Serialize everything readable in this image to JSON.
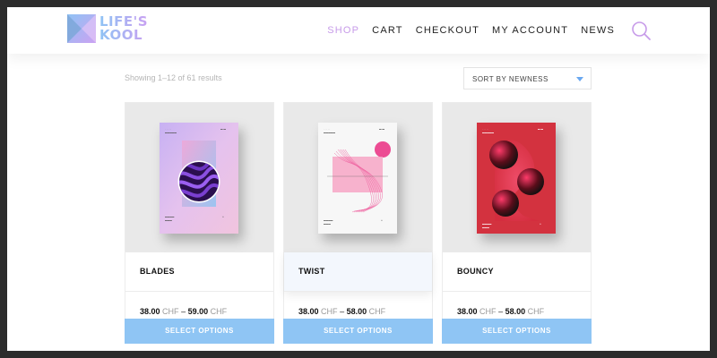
{
  "brand": {
    "logo_text_line1": "LIFE'S",
    "logo_text_line2": "KOOL",
    "accent": "#c79be9",
    "button_color": "#8fc5f4"
  },
  "nav": {
    "items": [
      {
        "label": "SHOP",
        "active": true
      },
      {
        "label": "CART",
        "active": false
      },
      {
        "label": "CHECKOUT",
        "active": false
      },
      {
        "label": "MY ACCOUNT",
        "active": false
      },
      {
        "label": "NEWS",
        "active": false
      }
    ],
    "search_icon": "search-icon"
  },
  "shop": {
    "result_count": "Showing 1–12 of 61 results",
    "sort_selected": "SORT BY NEWNESS"
  },
  "products": [
    {
      "title": "BLADES",
      "price_min": "38.00",
      "price_max": "59.00",
      "currency": "CHF",
      "separator": "–",
      "button_label": "SELECT OPTIONS"
    },
    {
      "title": "TWIST",
      "price_min": "38.00",
      "price_max": "58.00",
      "currency": "CHF",
      "separator": "–",
      "button_label": "SELECT OPTIONS"
    },
    {
      "title": "BOUNCY",
      "price_min": "38.00",
      "price_max": "58.00",
      "currency": "CHF",
      "separator": "–",
      "button_label": "SELECT OPTIONS"
    }
  ]
}
